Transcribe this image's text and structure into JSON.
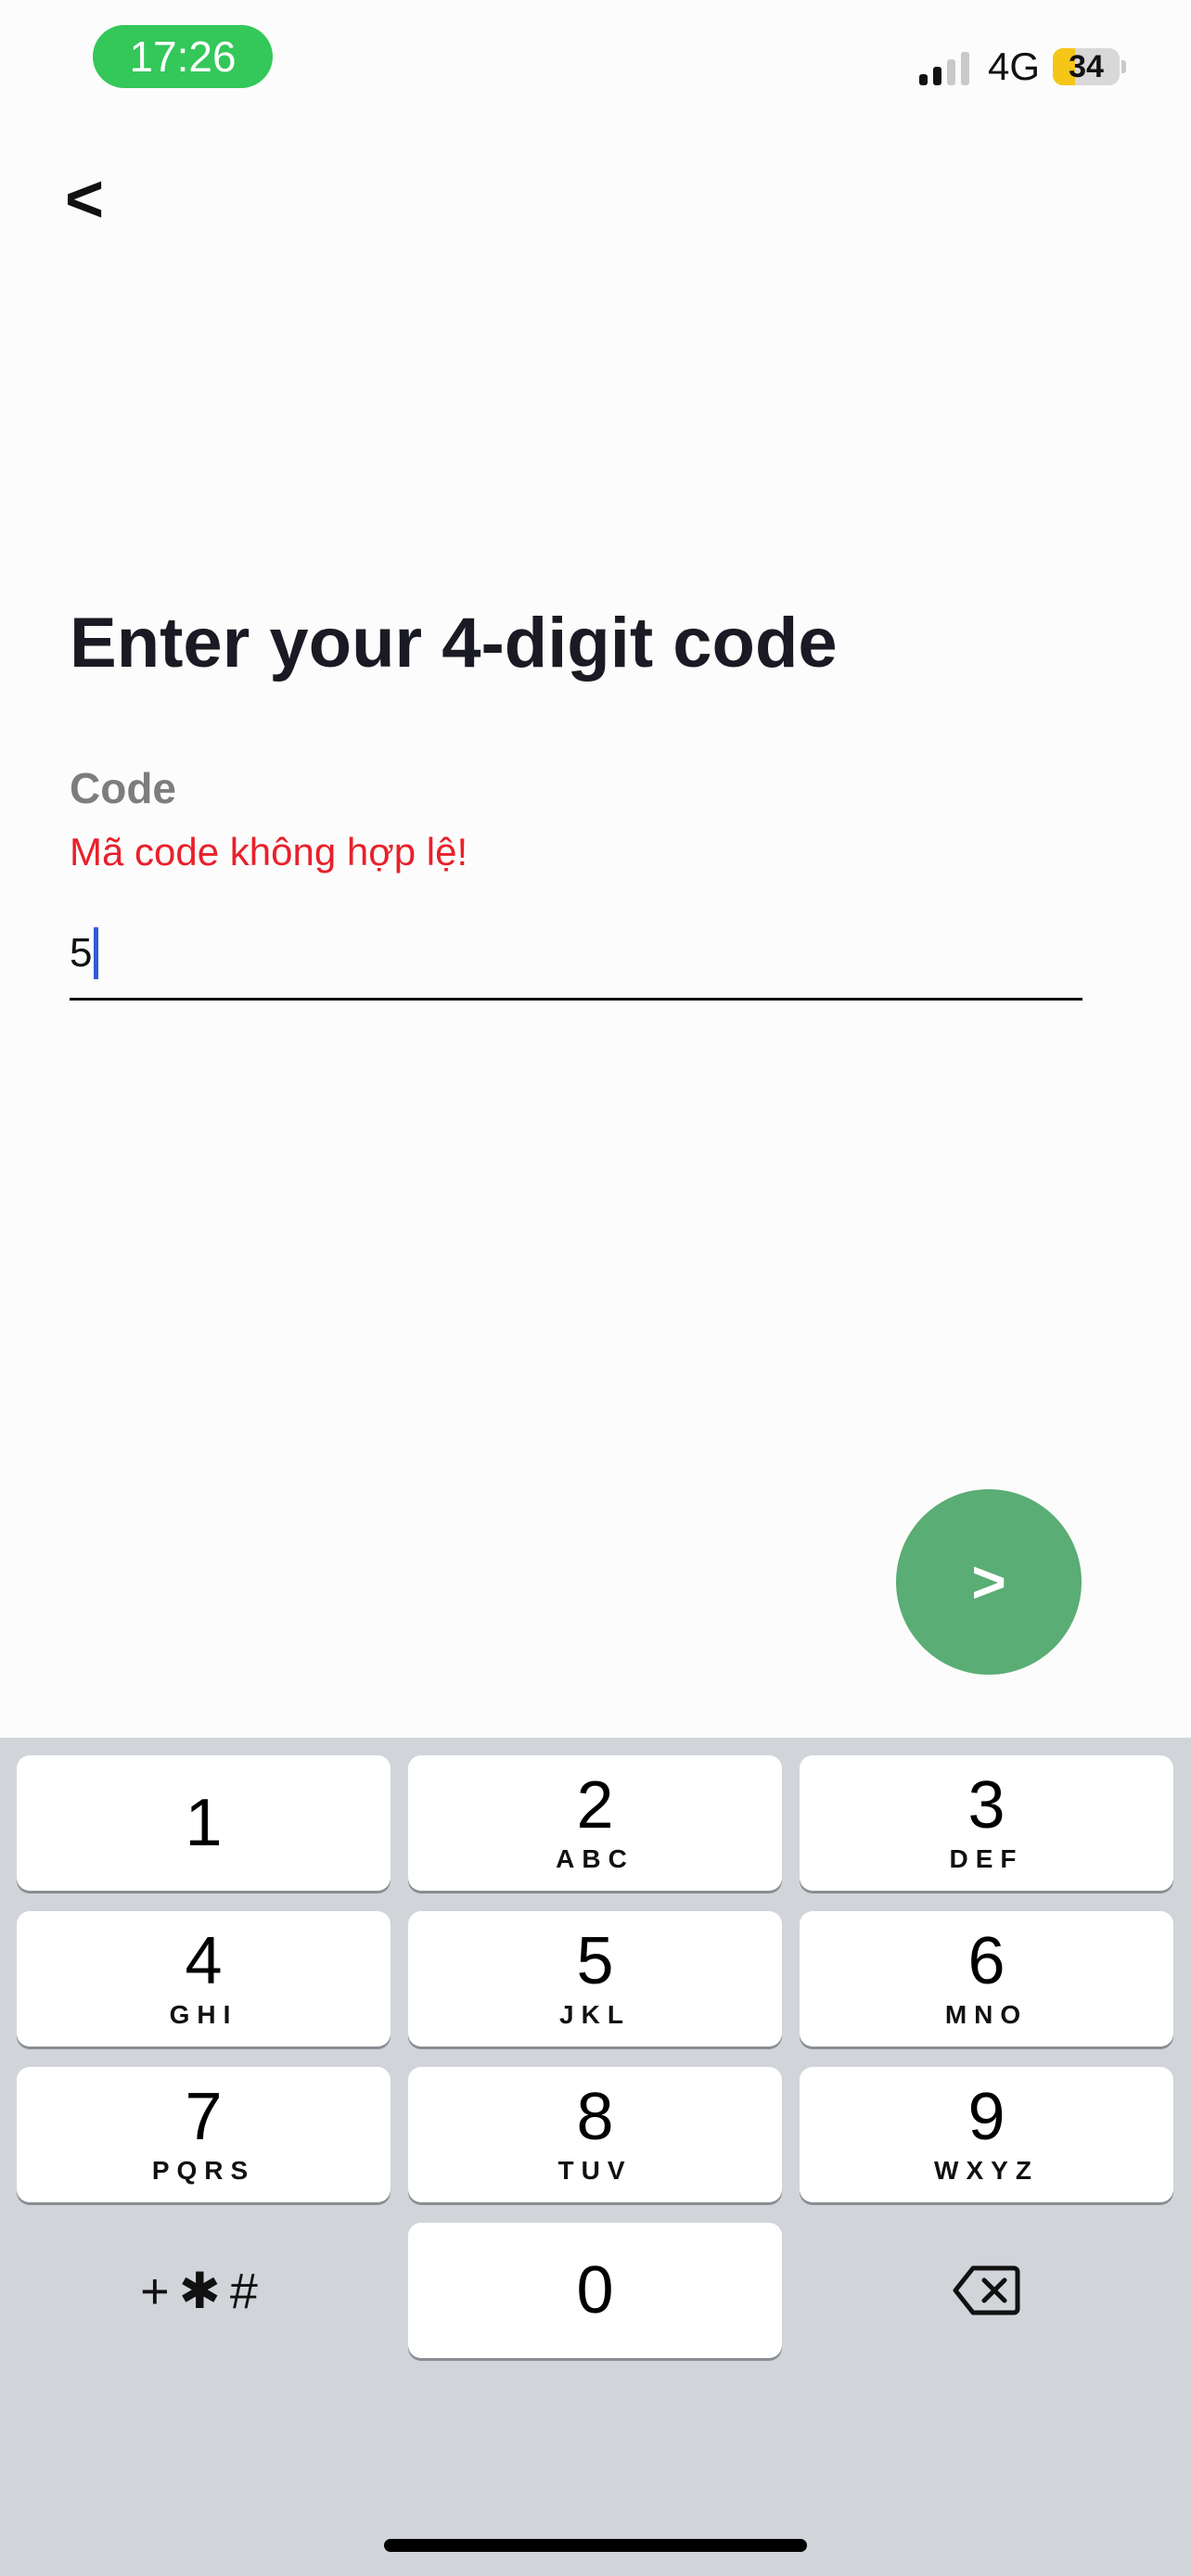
{
  "status_bar": {
    "time": "17:26",
    "network": "4G",
    "battery": "34",
    "battery_level": 0.34,
    "signal_bars_active": 2,
    "signal_bars_total": 4
  },
  "nav": {
    "back_label": "<"
  },
  "screen": {
    "title": "Enter your 4-digit code",
    "field_label": "Code",
    "error_message": "Mã code không hợp lệ!",
    "input_value": "5"
  },
  "next_button": {
    "label": ">",
    "color": "#5aad74"
  },
  "keypad": {
    "keys": [
      {
        "digit": "1",
        "letters": ""
      },
      {
        "digit": "2",
        "letters": "ABC"
      },
      {
        "digit": "3",
        "letters": "DEF"
      },
      {
        "digit": "4",
        "letters": "GHI"
      },
      {
        "digit": "5",
        "letters": "JKL"
      },
      {
        "digit": "6",
        "letters": "MNO"
      },
      {
        "digit": "7",
        "letters": "PQRS"
      },
      {
        "digit": "8",
        "letters": "TUV"
      },
      {
        "digit": "9",
        "letters": "WXYZ"
      },
      {
        "digit": "0",
        "letters": ""
      }
    ],
    "symbols_label": "+✱#",
    "delete_icon": "backspace-icon"
  }
}
